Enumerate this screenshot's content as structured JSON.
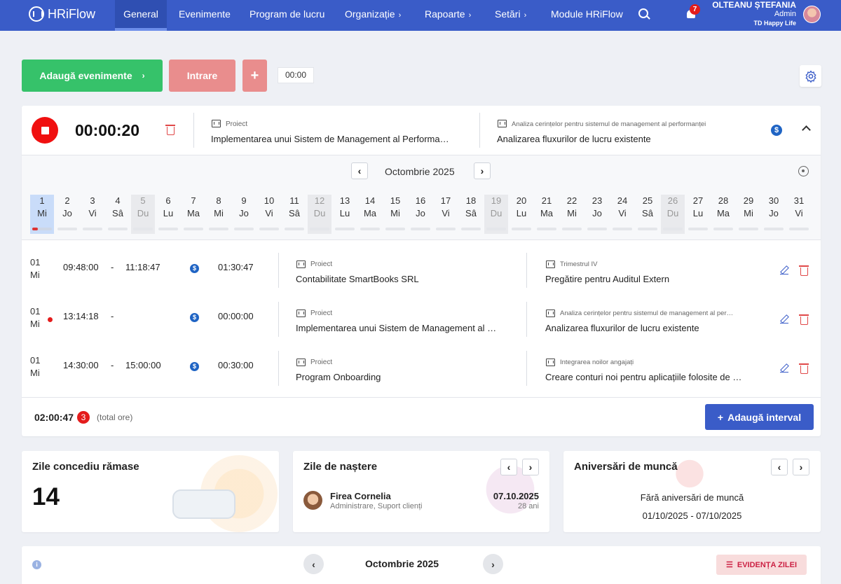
{
  "nav": {
    "logo": "HRiFlow",
    "items": [
      {
        "label": "General"
      },
      {
        "label": "Evenimente"
      },
      {
        "label": "Program de lucru"
      },
      {
        "label": "Organizație"
      },
      {
        "label": "Rapoarte"
      },
      {
        "label": "Setări"
      },
      {
        "label": "Module HRiFlow"
      }
    ],
    "notif_count": "7",
    "user_name": "OLTEANU ȘTEFANIA",
    "user_role": "Admin",
    "company": "TD Happy Life"
  },
  "toolbar": {
    "add_events": "Adaugă evenimente",
    "intrare": "Intrare",
    "plus": "+",
    "time": "00:00"
  },
  "timer": {
    "elapsed": "00:00:20",
    "project_label": "Proiect",
    "project": "Implementarea unui Sistem de Management al Performa…",
    "task_label": "Analiza cerințelor pentru sistemul de management al performanței",
    "task": "Analizarea fluxurilor de lucru existente"
  },
  "calendar": {
    "month": "Octombrie 2025",
    "days": [
      {
        "n": "1",
        "w": "Mi"
      },
      {
        "n": "2",
        "w": "Jo"
      },
      {
        "n": "3",
        "w": "Vi"
      },
      {
        "n": "4",
        "w": "Sâ"
      },
      {
        "n": "5",
        "w": "Du"
      },
      {
        "n": "6",
        "w": "Lu"
      },
      {
        "n": "7",
        "w": "Ma"
      },
      {
        "n": "8",
        "w": "Mi"
      },
      {
        "n": "9",
        "w": "Jo"
      },
      {
        "n": "10",
        "w": "Vi"
      },
      {
        "n": "11",
        "w": "Sâ"
      },
      {
        "n": "12",
        "w": "Du"
      },
      {
        "n": "13",
        "w": "Lu"
      },
      {
        "n": "14",
        "w": "Ma"
      },
      {
        "n": "15",
        "w": "Mi"
      },
      {
        "n": "16",
        "w": "Jo"
      },
      {
        "n": "17",
        "w": "Vi"
      },
      {
        "n": "18",
        "w": "Sâ"
      },
      {
        "n": "19",
        "w": "Du"
      },
      {
        "n": "20",
        "w": "Lu"
      },
      {
        "n": "21",
        "w": "Ma"
      },
      {
        "n": "22",
        "w": "Mi"
      },
      {
        "n": "23",
        "w": "Jo"
      },
      {
        "n": "24",
        "w": "Vi"
      },
      {
        "n": "25",
        "w": "Sâ"
      },
      {
        "n": "26",
        "w": "Du"
      },
      {
        "n": "27",
        "w": "Lu"
      },
      {
        "n": "28",
        "w": "Ma"
      },
      {
        "n": "29",
        "w": "Mi"
      },
      {
        "n": "30",
        "w": "Jo"
      },
      {
        "n": "31",
        "w": "Vi"
      }
    ]
  },
  "entries": [
    {
      "day": "01",
      "wd": "Mi",
      "start": "09:48:00",
      "sep": "-",
      "end": "11:18:47",
      "duration": "01:30:47",
      "project_label": "Proiect",
      "project": "Contabilitate SmartBooks SRL",
      "task_label": "Trimestrul IV",
      "task": "Pregătire pentru Auditul Extern"
    },
    {
      "day": "01",
      "wd": "Mi",
      "start": "13:14:18",
      "sep": "-",
      "end": "",
      "duration": "00:00:00",
      "project_label": "Proiect",
      "project": "Implementarea unui Sistem de Management al …",
      "task_label": "Analiza cerințelor pentru sistemul de management al per…",
      "task": "Analizarea fluxurilor de lucru existente"
    },
    {
      "day": "01",
      "wd": "Mi",
      "start": "14:30:00",
      "sep": "-",
      "end": "15:00:00",
      "duration": "00:30:00",
      "project_label": "Proiect",
      "project": "Program Onboarding",
      "task_label": "Integrarea noilor angajați",
      "task": "Creare conturi noi pentru aplicațiile folosite de …"
    }
  ],
  "summary": {
    "total": "02:00:47",
    "count": "3",
    "label": "(total ore)",
    "add_interval": "Adaugă interval"
  },
  "widgets": {
    "leave": {
      "title": "Zile concediu rămase",
      "value": "14"
    },
    "birthdays": {
      "title": "Zile de naștere",
      "name": "Firea Cornelia",
      "dept": "Administrare, Suport clienți",
      "date": "07.10.2025",
      "age": "28 ani"
    },
    "anniversaries": {
      "title": "Aniversări de muncă",
      "empty": "Fără aniversări de muncă",
      "range": "01/10/2025 - 07/10/2025"
    }
  },
  "bottom": {
    "month": "Octombrie 2025",
    "button": "EVIDENȚA ZILEI"
  },
  "colors": {
    "brand": "#3a5cc8",
    "green": "#36c26a",
    "danger": "#e41c1c"
  }
}
